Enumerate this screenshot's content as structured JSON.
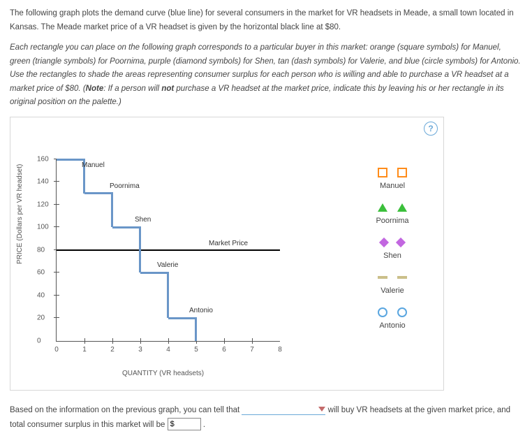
{
  "intro": {
    "p1": "The following graph plots the demand curve (blue line) for several consumers in the market for VR headsets in Meade, a small town located in Kansas. The Meade market price of a VR headset is given by the horizontal black line at $80.",
    "p2_a": "Each rectangle you can place on the following graph corresponds to a particular buyer in this market: orange (square symbols) for Manuel, green (triangle symbols) for Poornima, purple (diamond symbols) for Shen, tan (dash symbols) for Valerie, and blue (circle symbols) for Antonio. Use the rectangles to shade the areas representing consumer surplus for each person who is willing and able to purchase a VR headset at a market price of $80. (",
    "p2_note_label": "Note",
    "p2_b": ": If a person will ",
    "p2_not": "not",
    "p2_c": " purchase a VR headset at the market price, indicate this by leaving his or her rectangle in its original position on the palette.)"
  },
  "help": "?",
  "chart_data": {
    "type": "line",
    "xlabel": "QUANTITY (VR headsets)",
    "ylabel": "PRICE (Dollars per VR headset)",
    "xlim": [
      0,
      8
    ],
    "ylim": [
      0,
      160
    ],
    "x_ticks": [
      0,
      1,
      2,
      3,
      4,
      5,
      6,
      7,
      8
    ],
    "y_ticks": [
      0,
      20,
      40,
      60,
      80,
      100,
      120,
      140,
      160
    ],
    "market_price": 80,
    "market_price_label": "Market Price",
    "steps": [
      {
        "name": "Manuel",
        "from_x": 0,
        "to_x": 1,
        "price": 160
      },
      {
        "name": "Poornima",
        "from_x": 1,
        "to_x": 2,
        "price": 130
      },
      {
        "name": "Shen",
        "from_x": 2,
        "to_x": 3,
        "price": 100
      },
      {
        "name": "Valerie",
        "from_x": 3,
        "to_x": 4,
        "price": 60
      },
      {
        "name": "Antonio",
        "from_x": 4,
        "to_x": 5,
        "price": 20
      }
    ],
    "step_labels": {
      "manuel": "Manuel",
      "poornima": "Poornima",
      "shen": "Shen",
      "valerie": "Valerie",
      "antonio": "Antonio"
    }
  },
  "legend": {
    "manuel": "Manuel",
    "poornima": "Poornima",
    "shen": "Shen",
    "valerie": "Valerie",
    "antonio": "Antonio"
  },
  "answer": {
    "pre": "Based on the information on the previous graph, you can tell that ",
    "mid": " will buy VR headsets at the given market price, and total consumer surplus in this market will be ",
    "input_value": "$",
    "post": " ."
  }
}
